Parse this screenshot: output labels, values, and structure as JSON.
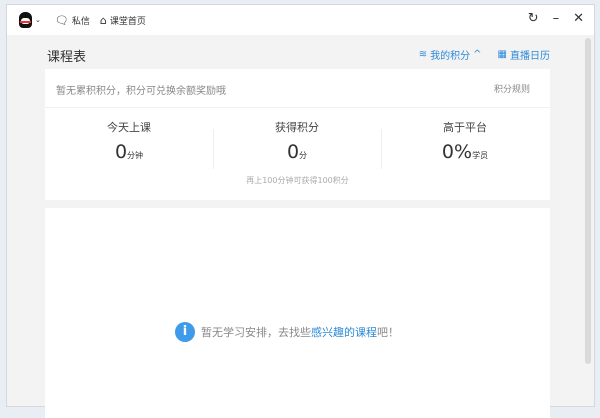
{
  "titlebar": {
    "messages": "私信",
    "home": "课堂首页"
  },
  "main": {
    "title": "课程表",
    "my_points": "我的积分",
    "calendar": "直播日历",
    "notice": "暂无累积积分，积分可兑换余额奖励哦",
    "rules": "积分规则",
    "stats": [
      {
        "label": "今天上课",
        "value": "0",
        "unit": "分钟"
      },
      {
        "label": "获得积分",
        "value": "0",
        "unit": "分"
      },
      {
        "label": "高于平台",
        "value": "0%",
        "unit": "学员"
      }
    ],
    "hint": "再上100分钟可获得100积分",
    "empty_prefix": "暂无学习安排，去找些",
    "empty_link": "感兴趣的课程",
    "empty_suffix": "吧！"
  },
  "colors": {
    "accent": "#2d8ad8"
  }
}
